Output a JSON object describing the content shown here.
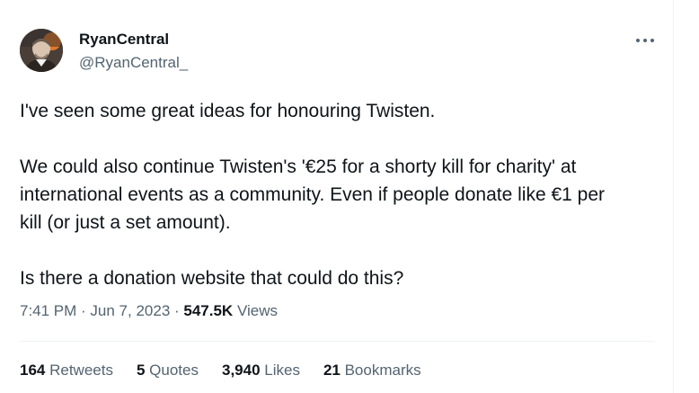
{
  "user": {
    "display_name": "RyanCentral",
    "handle": "@RyanCentral_",
    "avatar_icon": "profile-photo"
  },
  "tweet": {
    "line1": "I've seen some great ideas for honouring Twisten.",
    "paragraph2_line1": "We could also continue Twisten's '€25 for a shorty kill for charity' at",
    "paragraph2_line2": "international events as a community. Even if people donate like €1 per",
    "paragraph2_line3": "kill (or just a set amount).",
    "line3": "Is there a donation website that could do this?"
  },
  "meta": {
    "time": "7:41 PM",
    "separator": " · ",
    "date": "Jun 7, 2023",
    "views_count": "547.5K",
    "views_label": " Views"
  },
  "stats": [
    {
      "count": "164",
      "label": " Retweets"
    },
    {
      "count": "5",
      "label": " Quotes"
    },
    {
      "count": "3,940",
      "label": " Likes"
    },
    {
      "count": "21",
      "label": " Bookmarks"
    }
  ],
  "more_icon": "more-horizontal-icon",
  "colors": {
    "text_primary": "#0f1419",
    "text_secondary": "#536471",
    "divider": "#eff3f4"
  }
}
